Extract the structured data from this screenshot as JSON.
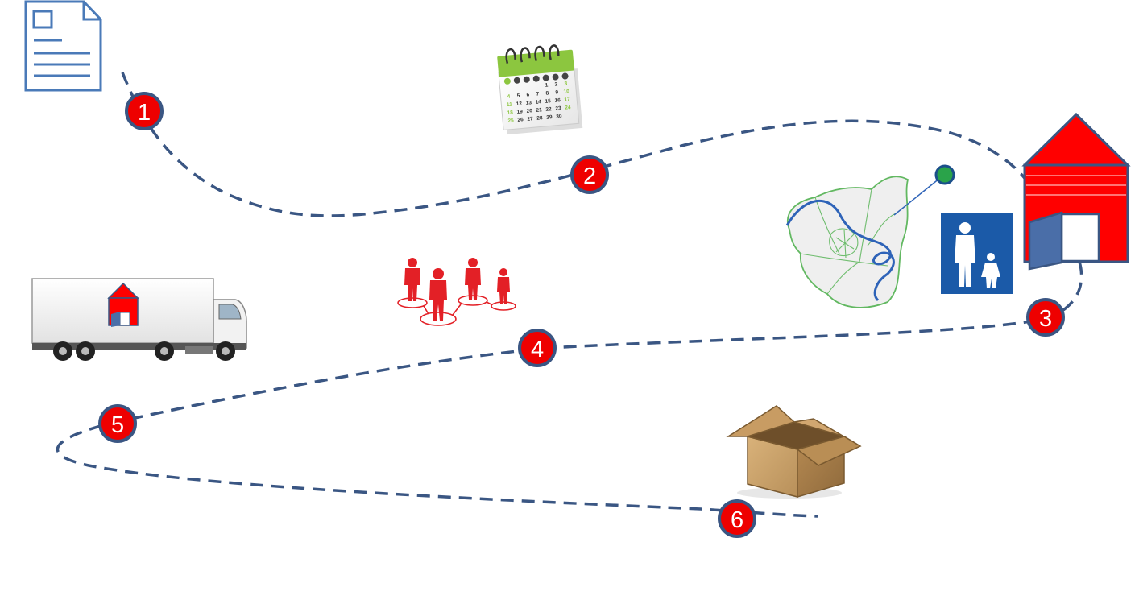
{
  "colors": {
    "route": "#3a5683",
    "marker_fill": "#ee0000",
    "marker_stroke": "#3a5683",
    "marker_text": "#ffffff",
    "house_red": "#ff0000",
    "house_blue": "#4a6ea8",
    "calendar_green": "#8cc63f",
    "map_green": "#62b861",
    "map_river": "#2e63b8",
    "sign_blue": "#1b5aa8",
    "people_red": "#e32026",
    "box_brown": "#a9814f"
  },
  "steps": [
    {
      "label": "1",
      "icon": "document-icon"
    },
    {
      "label": "2",
      "icon": "calendar-icon"
    },
    {
      "label": "3",
      "icon": "house-icon"
    },
    {
      "label": "4",
      "icon": "people-network-icon"
    },
    {
      "label": "5",
      "icon": "truck-icon"
    },
    {
      "label": "6",
      "icon": "open-box-icon"
    }
  ],
  "side_icons": [
    "district-map-icon",
    "pedestrian-sign-icon"
  ],
  "calendar": {
    "rows": [
      [
        "",
        "",
        "",
        "",
        "",
        "1",
        "2",
        "3"
      ],
      [
        "4",
        "5",
        "6",
        "7",
        "8",
        "9",
        "10"
      ],
      [
        "11",
        "12",
        "13",
        "14",
        "15",
        "16",
        "17"
      ],
      [
        "18",
        "19",
        "20",
        "21",
        "22",
        "23",
        "24"
      ],
      [
        "25",
        "26",
        "27",
        "28",
        "29",
        "30",
        ""
      ]
    ]
  }
}
